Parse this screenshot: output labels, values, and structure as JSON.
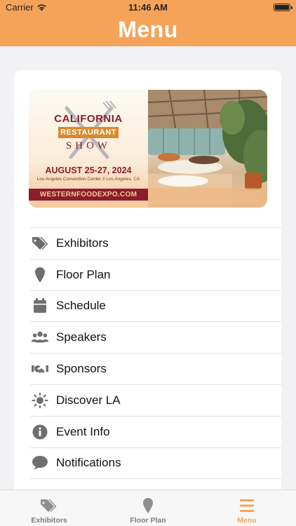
{
  "status_bar": {
    "carrier": "Carrier",
    "time": "11:46 AM"
  },
  "header": {
    "title": "Menu"
  },
  "banner": {
    "line1": "CALIFORNIA",
    "line2": "RESTAURANT",
    "line3": "SHOW",
    "dates": "AUGUST 25-27, 2024",
    "venue": "Los Angeles Convention Center // Los Angeles, CA",
    "url": "WESTERNFOODEXPO.COM"
  },
  "menu": {
    "items": [
      {
        "label": "Exhibitors",
        "icon": "tags-icon"
      },
      {
        "label": "Floor Plan",
        "icon": "map-pin-icon"
      },
      {
        "label": "Schedule",
        "icon": "calendar-icon"
      },
      {
        "label": "Speakers",
        "icon": "users-icon"
      },
      {
        "label": "Sponsors",
        "icon": "handshake-icon"
      },
      {
        "label": "Discover LA",
        "icon": "sun-icon"
      },
      {
        "label": "Event Info",
        "icon": "info-icon"
      },
      {
        "label": "Notifications",
        "icon": "chat-bubble-icon"
      }
    ]
  },
  "tabbar": {
    "tabs": [
      {
        "label": "Exhibitors",
        "icon": "tags-icon",
        "active": false
      },
      {
        "label": "Floor Plan",
        "icon": "map-pin-icon",
        "active": false
      },
      {
        "label": "Menu",
        "icon": "hamburger-icon",
        "active": true
      }
    ]
  },
  "colors": {
    "accent": "#f6a35a",
    "icon_gray": "#6e6e72",
    "brand_dark": "#8a1e2c"
  }
}
